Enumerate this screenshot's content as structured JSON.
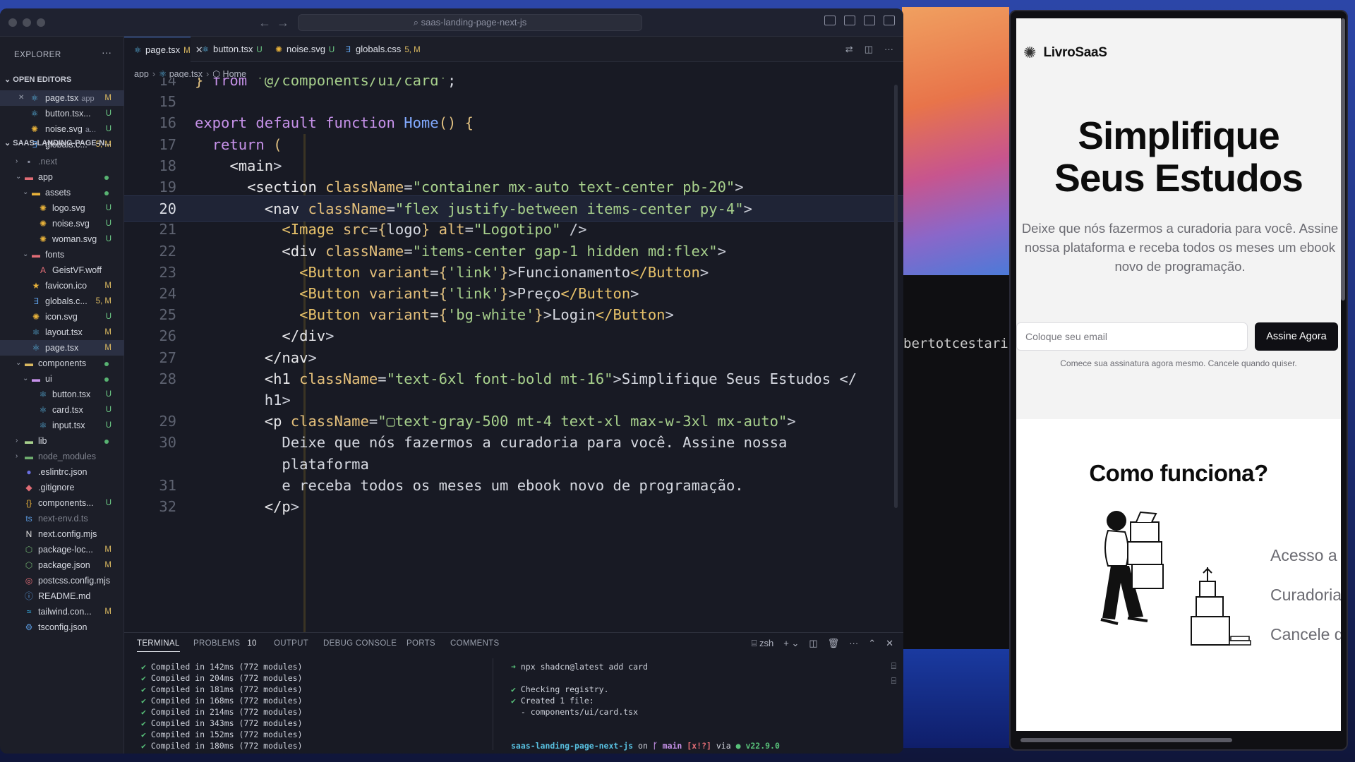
{
  "vscode": {
    "title": "saas-landing-page-next-js",
    "sidebar": {
      "header": "EXPLORER",
      "open_editors_header": "OPEN EDITORS",
      "project_header": "SAAS-LANDING-PAGE-N...",
      "open_editors": [
        {
          "name": "page.tsx",
          "sub": "app",
          "status": "M"
        },
        {
          "name": "button.tsx...",
          "sub": "",
          "status": "U"
        },
        {
          "name": "noise.svg",
          "sub": "a...",
          "status": "U"
        },
        {
          "name": "globals.c...",
          "sub": "",
          "status": "5, M"
        }
      ],
      "tree": [
        {
          "name": ".next",
          "status": ""
        },
        {
          "name": "app",
          "status": ""
        },
        {
          "name": "assets",
          "status": ""
        },
        {
          "name": "logo.svg",
          "status": "U"
        },
        {
          "name": "noise.svg",
          "status": "U"
        },
        {
          "name": "woman.svg",
          "status": "U"
        },
        {
          "name": "fonts",
          "status": ""
        },
        {
          "name": "GeistVF.woff",
          "status": ""
        },
        {
          "name": "favicon.ico",
          "status": "M"
        },
        {
          "name": "globals.c...",
          "status": "5, M"
        },
        {
          "name": "icon.svg",
          "status": "U"
        },
        {
          "name": "layout.tsx",
          "status": "M"
        },
        {
          "name": "page.tsx",
          "status": "M"
        },
        {
          "name": "components",
          "status": ""
        },
        {
          "name": "ui",
          "status": ""
        },
        {
          "name": "button.tsx",
          "status": "U"
        },
        {
          "name": "card.tsx",
          "status": "U"
        },
        {
          "name": "input.tsx",
          "status": "U"
        },
        {
          "name": "lib",
          "status": ""
        },
        {
          "name": "node_modules",
          "status": ""
        },
        {
          "name": ".eslintrc.json",
          "status": ""
        },
        {
          "name": ".gitignore",
          "status": ""
        },
        {
          "name": "components...",
          "status": "U"
        },
        {
          "name": "next-env.d.ts",
          "status": ""
        },
        {
          "name": "next.config.mjs",
          "status": ""
        },
        {
          "name": "package-loc...",
          "status": "M"
        },
        {
          "name": "package.json",
          "status": "M"
        },
        {
          "name": "postcss.config.mjs",
          "status": ""
        },
        {
          "name": "README.md",
          "status": ""
        },
        {
          "name": "tailwind.con...",
          "status": "M"
        },
        {
          "name": "tsconfig.json",
          "status": ""
        }
      ]
    },
    "tabs": [
      {
        "name": "page.tsx",
        "badge": "M"
      },
      {
        "name": "button.tsx",
        "badge": "U"
      },
      {
        "name": "noise.svg",
        "badge": "U"
      },
      {
        "name": "globals.css",
        "badge": "5, M"
      }
    ],
    "breadcrumb": [
      "app",
      "page.tsx",
      "Home"
    ],
    "code_lines": [
      {
        "n": "14",
        "text": "} from '@/components/ui/card';"
      },
      {
        "n": "15",
        "text": ""
      },
      {
        "n": "16",
        "text": "export default function Home() {"
      },
      {
        "n": "17",
        "text": "  return ("
      },
      {
        "n": "18",
        "text": "    <main>"
      },
      {
        "n": "19",
        "text": "      <section className=\"container mx-auto text-center pb-20\">"
      },
      {
        "n": "20",
        "text": "        <nav className=\"flex justify-between items-center py-4\">"
      },
      {
        "n": "21",
        "text": "          <Image src={logo} alt=\"Logotipo\" />"
      },
      {
        "n": "22",
        "text": "          <div className=\"items-center gap-1 hidden md:flex\">"
      },
      {
        "n": "23",
        "text": "            <Button variant={'link'}>Funcionamento</Button>"
      },
      {
        "n": "24",
        "text": "            <Button variant={'link'}>Preço</Button>"
      },
      {
        "n": "25",
        "text": "            <Button variant={'bg-white'}>Login</Button>"
      },
      {
        "n": "26",
        "text": "          </div>"
      },
      {
        "n": "27",
        "text": "        </nav>"
      },
      {
        "n": "28",
        "text": "        <h1 className=\"text-6xl font-bold mt-16\">Simplifique Seus Estudos </"
      },
      {
        "n": "",
        "text": "        h1>"
      },
      {
        "n": "29",
        "text": "        <p className=\"▢text-gray-500 mt-4 text-xl max-w-3xl mx-auto\">"
      },
      {
        "n": "30",
        "text": "          Deixe que nós fazermos a curadoria para você. Assine nossa"
      },
      {
        "n": "",
        "text": "          plataforma"
      },
      {
        "n": "31",
        "text": "          e receba todos os meses um ebook novo de programação."
      },
      {
        "n": "32",
        "text": "        </p>"
      }
    ],
    "highlight_line": "20",
    "panel": {
      "tabs": [
        "TERMINAL",
        "PROBLEMS",
        "OUTPUT",
        "DEBUG CONSOLE",
        "PORTS",
        "COMMENTS"
      ],
      "problems_count": "10",
      "shell": "zsh",
      "compiled": [
        "Compiled in 142ms (772 modules)",
        "Compiled in 204ms (772 modules)",
        "Compiled in 181ms (772 modules)",
        "Compiled in 168ms (772 modules)",
        "Compiled in 214ms (772 modules)",
        "Compiled in 343ms (772 modules)",
        "Compiled in 152ms (772 modules)",
        "Compiled in 180ms (772 modules)"
      ],
      "cmd": "npx shadcn@latest add card",
      "checking": "Checking registry.",
      "created": "Created 1 file:",
      "created_file": "- components/ui/card.tsx",
      "prompt_repo": "saas-landing-page-next-js",
      "prompt_on": "on",
      "prompt_branch": "main",
      "prompt_flags": "[x!?]",
      "prompt_via": "via",
      "prompt_node": "v22.9.0"
    }
  },
  "desktop": {
    "terminal_peek": "bertotcestari/"
  },
  "browser": {
    "logo_text": "LivroSaaS",
    "hero_title_1": "Simplifique",
    "hero_title_2": "Seus Estudos",
    "hero_sub": "Deixe que nós fazermos a curadoria para você. Assine nossa plataforma e receba todos os meses um ebook novo de programação.",
    "email_placeholder": "Coloque seu email",
    "subscribe_label": "Assine Agora",
    "hero_note": "Comece sua assinatura agora mesmo. Cancele quando quiser.",
    "how_title": "Como funciona?",
    "features": [
      "Acesso a",
      "Curadoria",
      "Cancele q"
    ]
  },
  "colors": {
    "accent": "#4a7bd8",
    "modified": "#d9b860",
    "untracked": "#6fcf88",
    "button_dark": "#0f0f14"
  }
}
